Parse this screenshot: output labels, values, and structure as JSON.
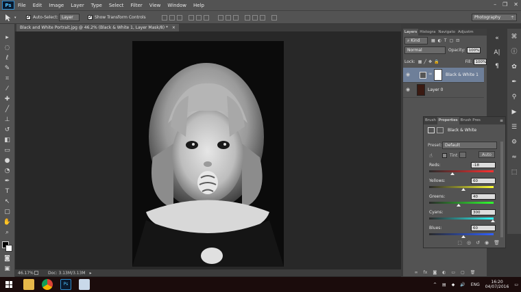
{
  "app": {
    "logo": "Ps"
  },
  "menu": [
    "File",
    "Edit",
    "Image",
    "Layer",
    "Type",
    "Select",
    "Filter",
    "View",
    "Window",
    "Help"
  ],
  "window_controls": {
    "minimize": "–",
    "restore": "❐",
    "close": "✕"
  },
  "options_bar": {
    "auto_select_label": "Auto-Select:",
    "auto_select_checked": "✔",
    "auto_select_target": "Layer",
    "transform_controls_label": "Show Transform Controls",
    "transform_checked": "✔",
    "workspace": "Photography"
  },
  "document_tab": {
    "title": "Black and White Portrait.jpg @ 46.2% (Black & White 1, Layer Mask/8) *",
    "close": "×"
  },
  "status_bar": {
    "zoom": "46.17%",
    "doc_info": "Doc: 3.13M/3.13M"
  },
  "layers_panel": {
    "tabs": [
      "Layers",
      "Histogra",
      "Navigato",
      "Adjustm"
    ],
    "filter_kind": "Kind",
    "blend_mode": "Normal",
    "opacity_label": "Opacity:",
    "opacity_value": "100%",
    "lock_label": "Lock:",
    "fill_label": "Fill:",
    "fill_value": "100%",
    "layers": [
      {
        "name": "Black & White 1",
        "selected": true
      },
      {
        "name": "Layer 0",
        "selected": false
      }
    ]
  },
  "properties_panel": {
    "tabs": [
      "Brush",
      "Properties",
      "Brush Pres"
    ],
    "title": "Black & White",
    "preset_label": "Preset:",
    "preset_value": "Default",
    "tint_label": "Tint",
    "auto_button": "Auto",
    "sliders": [
      {
        "label": "Reds:",
        "value": "-18",
        "level": 0.36
      },
      {
        "label": "Yellows:",
        "value": "60",
        "level": 0.53
      },
      {
        "label": "Greens:",
        "value": "40",
        "level": 0.46
      },
      {
        "label": "Cyans:",
        "value": "300",
        "level": 0.99
      },
      {
        "label": "Blues:",
        "value": "60",
        "level": 0.53
      }
    ]
  },
  "taskbar": {
    "lang": "ENG",
    "time": "16:20",
    "date": "04/07/2016"
  },
  "colors": {
    "accent_selected_layer": "#6e7f99",
    "menu_bg": "#535353",
    "canvas_bg": "#282828"
  }
}
